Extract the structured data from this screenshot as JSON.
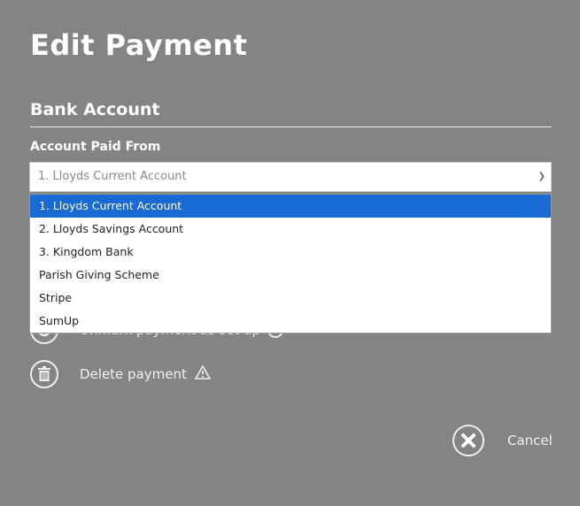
{
  "title": "Edit Payment",
  "section": "Bank Account",
  "field_label": "Account Paid From",
  "select_value": "1. Lloyds Current Account",
  "options": [
    "1. Lloyds Current Account",
    "2. Lloyds Savings Account",
    "3. Kingdom Bank",
    "Parish Giving Scheme",
    "Stripe",
    "SumUp"
  ],
  "actions": {
    "unmark": "Unmark payment as set up",
    "delete": "Delete payment",
    "cancel": "Cancel"
  },
  "colors": {
    "background": "#848484",
    "selected": "#1a6ad6"
  }
}
